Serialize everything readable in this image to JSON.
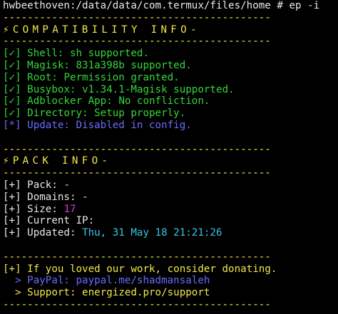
{
  "prompt": {
    "host_path": "hwbeethoven:/data/data/com.termux/files/home # ",
    "command": "ep -i"
  },
  "separator": "--------------------------------------------",
  "compat": {
    "title": "⚡COMPATIBILITY INFO-",
    "items": [
      {
        "mark": "[✓]",
        "label": "Shell:",
        "value": "sh supported."
      },
      {
        "mark": "[✓]",
        "label": "Magisk:",
        "value": "831a398b supported."
      },
      {
        "mark": "[✓]",
        "label": "Root:",
        "value": "Permission granted."
      },
      {
        "mark": "[✓]",
        "label": "Busybox:",
        "value": "v1.34.1-Magisk supported."
      },
      {
        "mark": "[✓]",
        "label": "Adblocker App:",
        "value": "No confliction."
      },
      {
        "mark": "[✓]",
        "label": "Directory:",
        "value": "Setup properly."
      }
    ],
    "update": {
      "mark": "[*]",
      "label": "Update:",
      "value": "Disabled in config."
    }
  },
  "pack": {
    "title": "⚡PACK INFO-",
    "items": [
      {
        "mark": "[+]",
        "label": "Pack:",
        "value": "-"
      },
      {
        "mark": "[+]",
        "label": "Domains:",
        "value": "-"
      },
      {
        "mark": "[+]",
        "label": "Size:",
        "value": "17"
      },
      {
        "mark": "[+]",
        "label": "Current IP:",
        "value": ""
      },
      {
        "mark": "[+]",
        "label": "Updated:",
        "value": "Thu, 31 May 18 21:21:26"
      }
    ]
  },
  "donate": {
    "message": "[+] If you loved our work, consider donating.",
    "paypal_prefix": "  > PayPal:",
    "paypal_value": "paypal.me/shadmansaleh",
    "support": "  > Support: energized.pro/support"
  }
}
